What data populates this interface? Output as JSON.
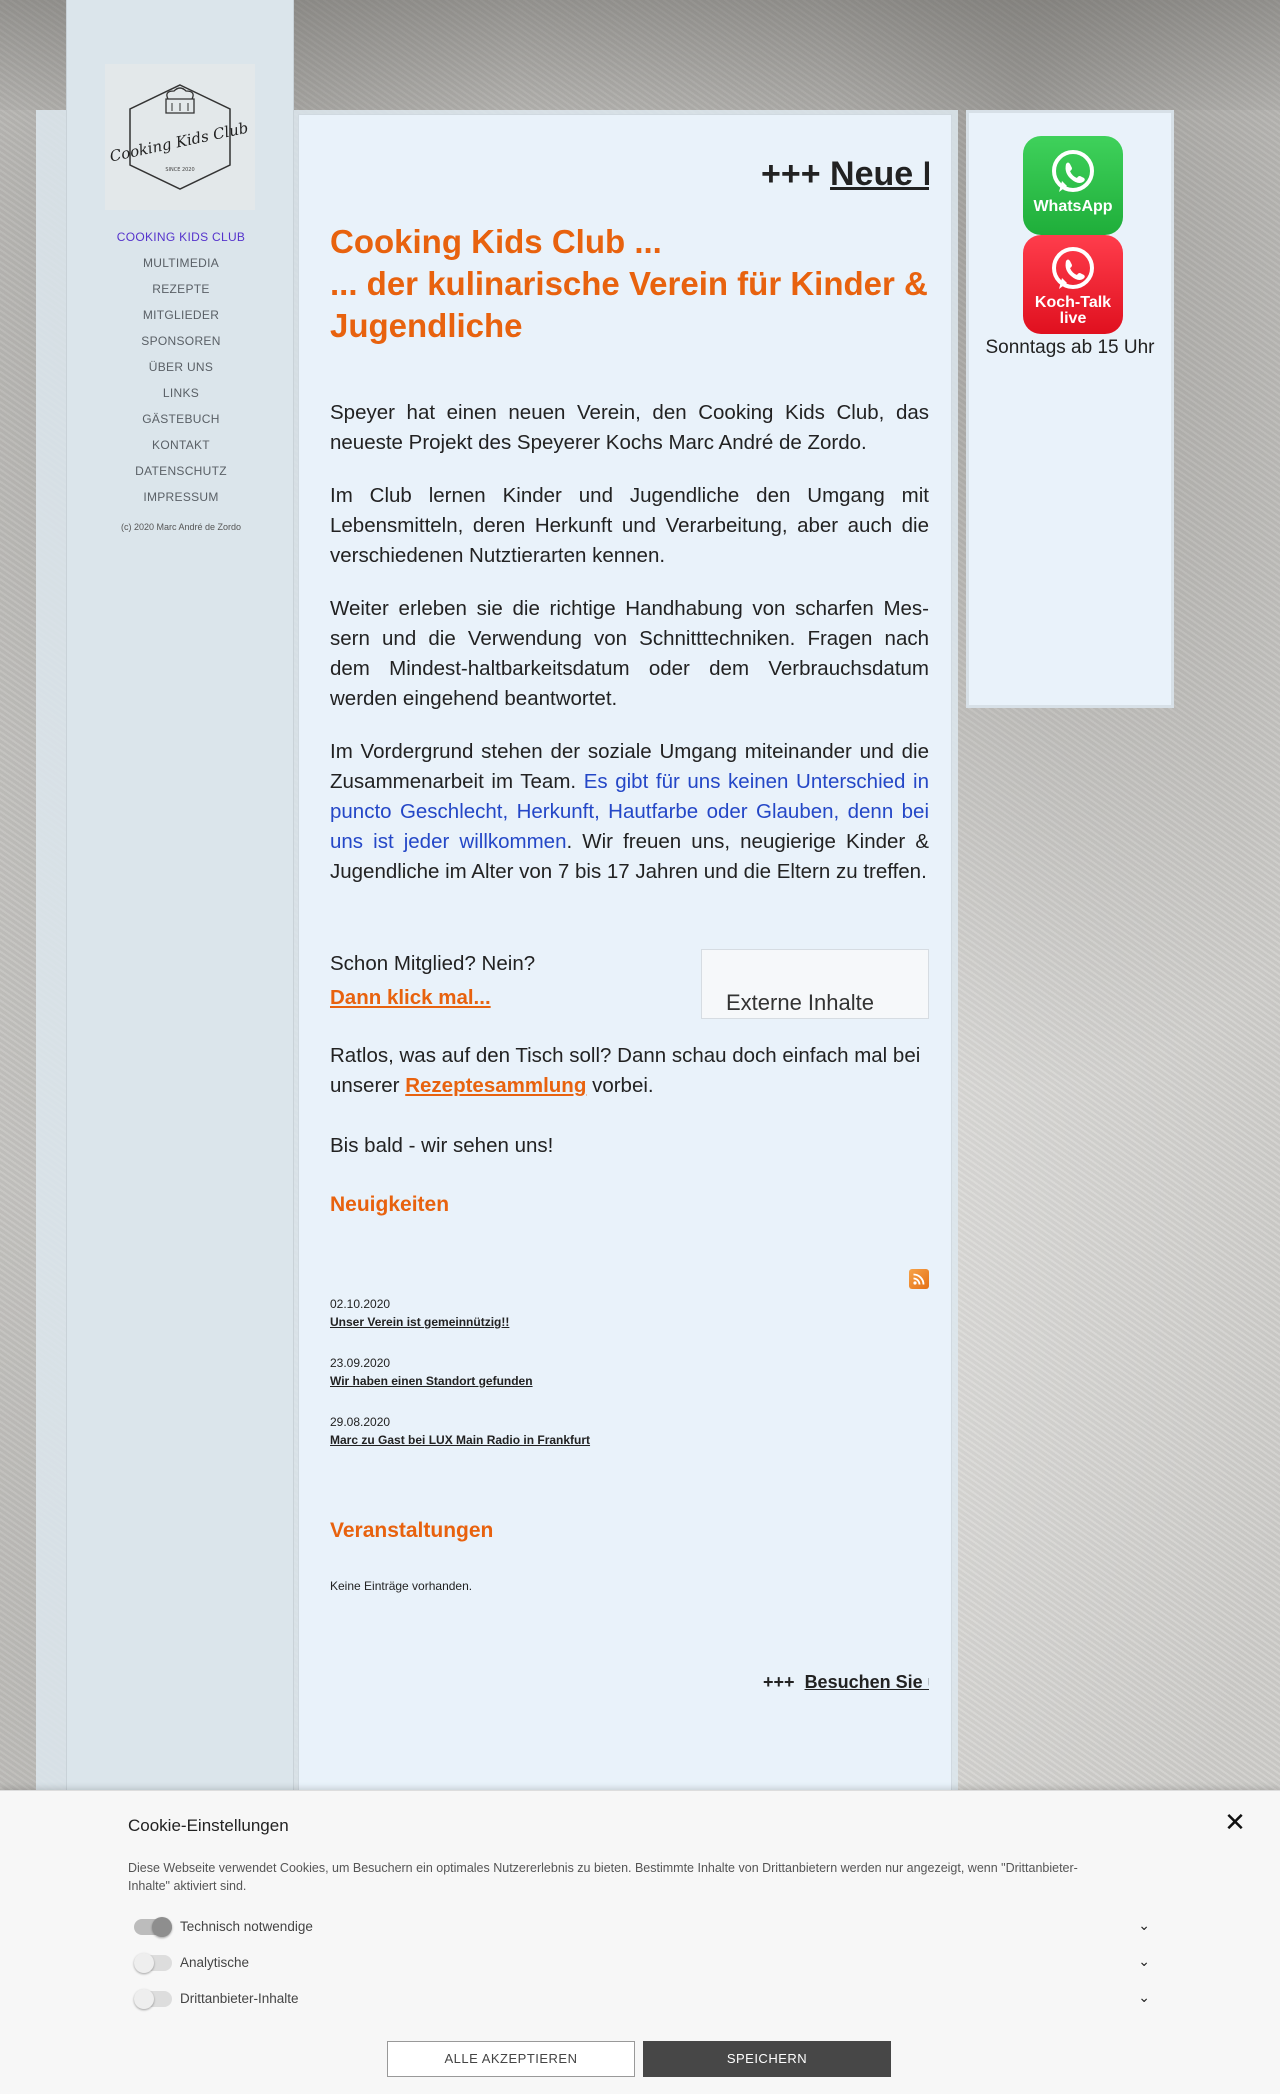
{
  "ticker_top": {
    "prefix": "+++",
    "link": "Neue Homepage"
  },
  "logo": {
    "text": "Cooking Kids Club",
    "since": "SINCE 2020"
  },
  "nav": {
    "items": [
      "COOKING KIDS CLUB",
      "MULTIMEDIA",
      "REZEPTE",
      "MITGLIEDER",
      "SPONSOREN",
      "ÜBER UNS",
      "LINKS",
      "GÄSTEBUCH",
      "KONTAKT",
      "DATENSCHUTZ",
      "IMPRESSUM"
    ],
    "copyright": "(c) 2020 Marc André de Zordo"
  },
  "headline": {
    "line1": "Cooking Kids Club ...",
    "line2": "... der kulinarische Verein für Kinder & Jugendliche"
  },
  "paragraphs": {
    "p1": "Speyer hat einen neuen Verein, den Cooking Kids Club, das neueste Projekt des Speyerer Kochs Marc André de Zordo.",
    "p2": "Im Club lernen Kinder und Jugendliche den Umgang mit Lebensmitteln, deren Herkunft und Verarbeitung, aber auch die verschiedenen Nutztierarten kennen.",
    "p3": "Weiter erleben sie die richtige Handhabung von scharfen Mes­sern und die Verwendung von Schnitttechniken. Fragen nach dem Mindest-haltbarkeitsdatum oder dem Verbrauchsdatum werden eingehend beantwortet.",
    "p4_a": "Im Vordergrund stehen der soziale Umgang miteinander und die Zusammenarbeit im Team.",
    "p4_blue": "Es gibt für uns keinen Unterschied in puncto Geschlecht, Herkunft, Hautfarbe oder Glauben, denn bei uns ist jeder willkommen",
    "p4_b": ". Wir freuen uns, neugierige Kinder & Jugendliche im Alter von 7 bis 17 Jahren und die Eltern zu treffen.",
    "member_q": "Schon Mitglied? Nein?",
    "member_link": "Dann klick mal...",
    "recipes_a": "Ratlos, was auf den Tisch soll? Dann schau doch einfach mal bei unserer",
    "recipes_link": "Rezeptesammlung",
    "recipes_b": "vorbei.",
    "bye": "Bis bald - wir sehen uns!"
  },
  "external": {
    "label": "Externe Inhalte"
  },
  "news": {
    "title": "Neuigkeiten",
    "items": [
      {
        "date": "02.10.2020",
        "title": "Unser Verein ist gemeinnützig!!"
      },
      {
        "date": "23.09.2020",
        "title": "Wir haben einen Standort gefunden"
      },
      {
        "date": "29.08.2020",
        "title": "Marc zu Gast bei LUX Main Radio in Frankfurt"
      }
    ]
  },
  "events": {
    "title": "Veranstaltungen",
    "empty": "Keine Einträge vorhanden."
  },
  "ticker_bottom": {
    "prefix": "+++",
    "link": "Besuchen Sie uns"
  },
  "right": {
    "whatsapp": "WhatsApp",
    "kochtalk_1": "Koch-Talk",
    "kochtalk_2": "live",
    "sundays": "Sonntags ab 15 Uhr"
  },
  "cookie": {
    "title": "Cookie-Einstellungen",
    "text": "Diese Webseite verwendet Cookies, um Besuchern ein optimales Nutzererlebnis zu bieten. Bestimmte Inhalte von Drittanbietern werden nur angezeigt, wenn \"Drittanbieter-Inhalte\" aktiviert sind.",
    "options": [
      {
        "label": "Technisch notwendige",
        "enabled": true
      },
      {
        "label": "Analytische",
        "enabled": false
      },
      {
        "label": "Drittanbieter-Inhalte",
        "enabled": false
      }
    ],
    "accept": "ALLE AKZEPTIEREN",
    "save": "SPEICHERN"
  },
  "colors": {
    "accent": "#e8620e",
    "link_blue": "#2447c7",
    "whatsapp_green": "#25d366",
    "kochtalk_red": "#f21d2d"
  }
}
